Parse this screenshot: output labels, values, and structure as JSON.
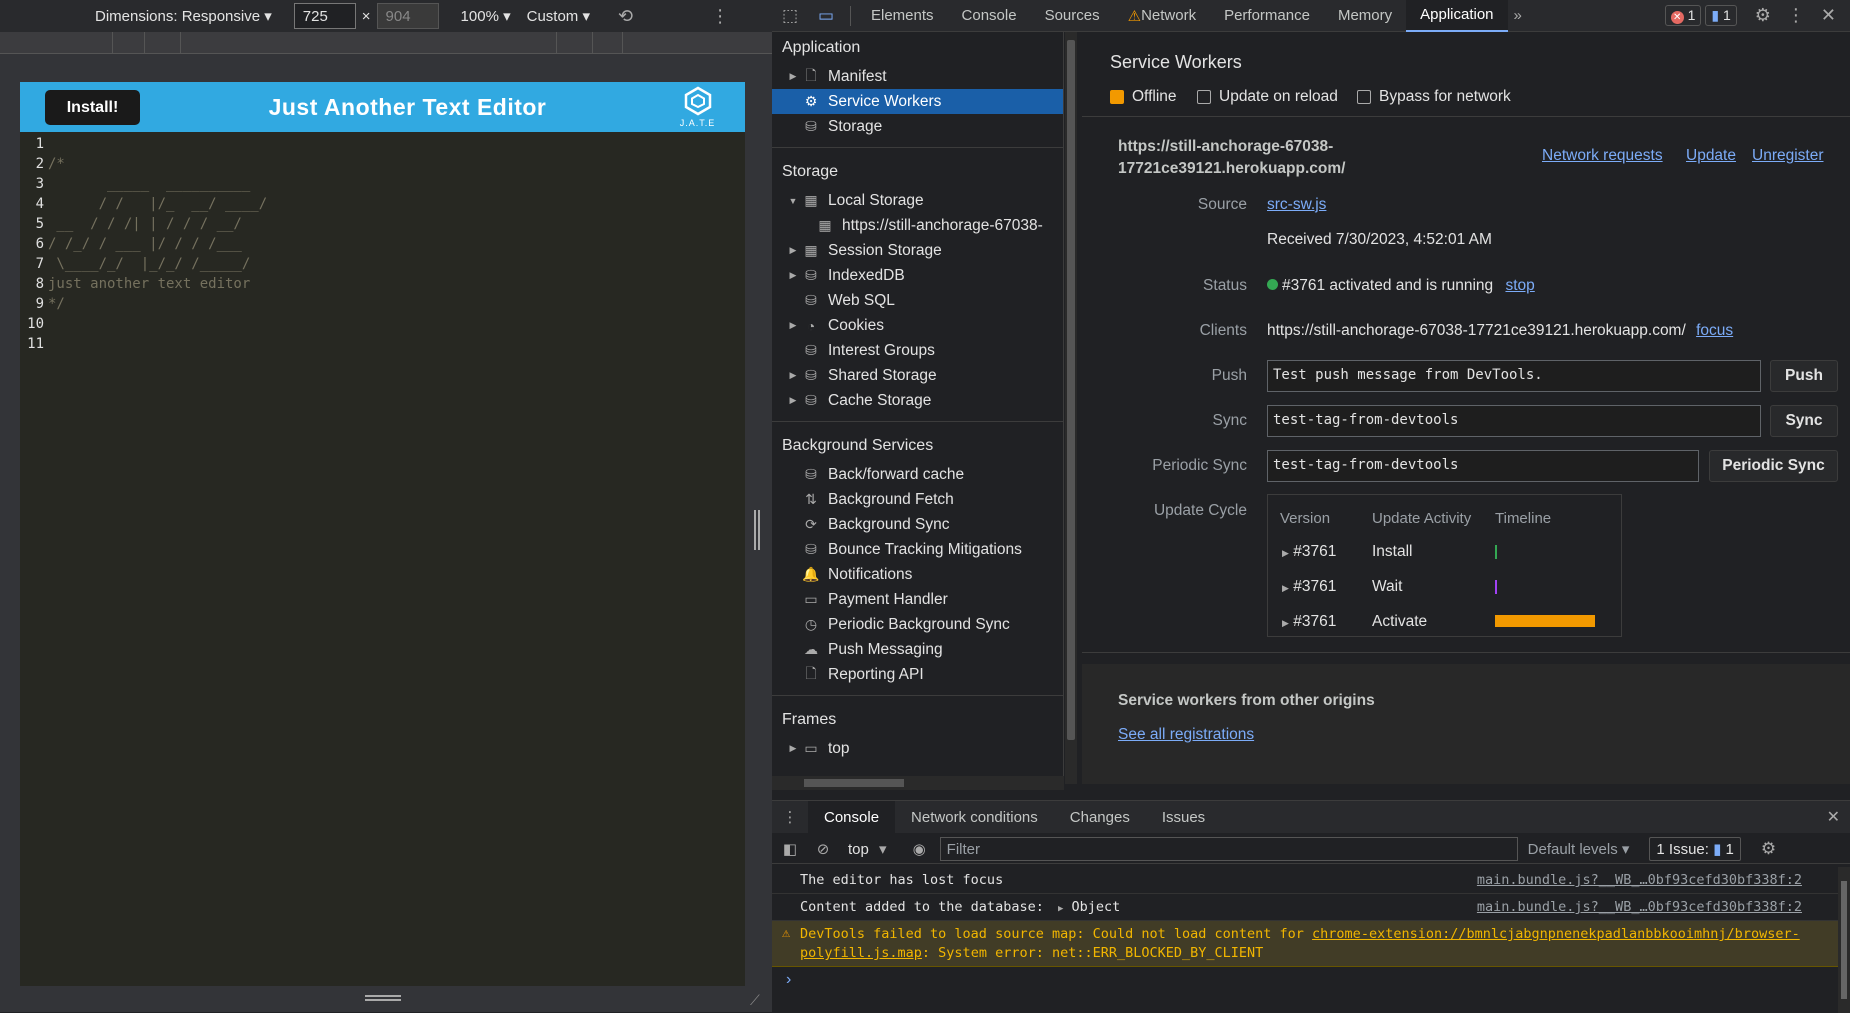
{
  "device_toolbar": {
    "dimensions_label": "Dimensions: Responsive",
    "width": "725",
    "height_placeholder": "904",
    "times": "×",
    "zoom": "100%",
    "throttle": "Custom"
  },
  "app": {
    "install_label": "Install!",
    "title": "Just Another Text Editor",
    "logo_text": "J.A.T.E",
    "code_lines": [
      {
        "n": "1",
        "t": ""
      },
      {
        "n": "2",
        "t": "/*"
      },
      {
        "n": "3",
        "t": "       _____  __________"
      },
      {
        "n": "4",
        "t": "      / /   |/_  __/ ____/"
      },
      {
        "n": "5",
        "t": " __  / / /| | / / / __/"
      },
      {
        "n": "6",
        "t": "/ /_/ / ___ |/ / / /___"
      },
      {
        "n": "7",
        "t": " \\____/_/  |_/_/ /_____/"
      },
      {
        "n": "8",
        "t": "just another text editor"
      },
      {
        "n": "9",
        "t": "*/"
      },
      {
        "n": "10",
        "t": ""
      },
      {
        "n": "11",
        "t": ""
      }
    ]
  },
  "devtools": {
    "tabs": [
      "Elements",
      "Console",
      "Sources",
      "Network",
      "Performance",
      "Memory",
      "Application"
    ],
    "active_tab": "Application",
    "error_count": "1",
    "message_count": "1",
    "sidebar": {
      "application_header": "Application",
      "application_items": [
        "Manifest",
        "Service Workers",
        "Storage"
      ],
      "storage_header": "Storage",
      "storage_items": [
        "Local Storage",
        "https://still-anchorage-67038-",
        "Session Storage",
        "IndexedDB",
        "Web SQL",
        "Cookies",
        "Interest Groups",
        "Shared Storage",
        "Cache Storage"
      ],
      "background_header": "Background Services",
      "background_items": [
        "Back/forward cache",
        "Background Fetch",
        "Background Sync",
        "Bounce Tracking Mitigations",
        "Notifications",
        "Payment Handler",
        "Periodic Background Sync",
        "Push Messaging",
        "Reporting API"
      ],
      "frames_header": "Frames",
      "frames_items": [
        "top"
      ]
    },
    "sw": {
      "title": "Service Workers",
      "offline": "Offline",
      "update_on_reload": "Update on reload",
      "bypass": "Bypass for network",
      "origin": "https://still-anchorage-67038-17721ce39121.herokuapp.com/",
      "origin_line1": "https://still-anchorage-67038-",
      "origin_line2": "17721ce39121.herokuapp.com/",
      "network_requests": "Network requests",
      "update": "Update",
      "unregister": "Unregister",
      "source_label": "Source",
      "source_value": "src-sw.js",
      "received": "Received 7/30/2023, 4:52:01 AM",
      "status_label": "Status",
      "status_value": "#3761 activated and is running",
      "stop": "stop",
      "clients_label": "Clients",
      "clients_value": "https://still-anchorage-67038-17721ce39121.herokuapp.com/",
      "focus": "focus",
      "push_label": "Push",
      "push_value": "Test push message from DevTools.",
      "push_button": "Push",
      "sync_label": "Sync",
      "sync_value": "test-tag-from-devtools",
      "sync_button": "Sync",
      "periodic_label": "Periodic Sync",
      "periodic_value": "test-tag-from-devtools",
      "periodic_button": "Periodic Sync",
      "update_cycle_label": "Update Cycle",
      "cycle_headers": [
        "Version",
        "Update Activity",
        "Timeline"
      ],
      "cycle_rows": [
        {
          "version": "#3761",
          "activity": "Install"
        },
        {
          "version": "#3761",
          "activity": "Wait"
        },
        {
          "version": "#3761",
          "activity": "Activate"
        }
      ],
      "other_origins": "Service workers from other origins",
      "see_all": "See all registrations"
    },
    "drawer": {
      "tabs": [
        "Console",
        "Network conditions",
        "Changes",
        "Issues"
      ],
      "context": "top",
      "filter_placeholder": "Filter",
      "levels": "Default levels",
      "issues": "1 Issue:",
      "issues_count": "1",
      "lines": [
        {
          "text": "The editor has lost focus",
          "src": "main.bundle.js?__WB_…0bf93cefd30bf338f:2"
        },
        {
          "text": "Content added to the database:",
          "obj": "Object",
          "src": "main.bundle.js?__WB_…0bf93cefd30bf338f:2"
        }
      ],
      "warning_prefix": "DevTools failed to load source map: Could not load content for ",
      "warning_link": "chrome-extension://bmnlcjabgnpnenekpadlanbbkooimhnj/browser-polyfill.js.map",
      "warning_suffix": ": System error: net::ERR_BLOCKED_BY_CLIENT",
      "prompt": "›"
    }
  }
}
